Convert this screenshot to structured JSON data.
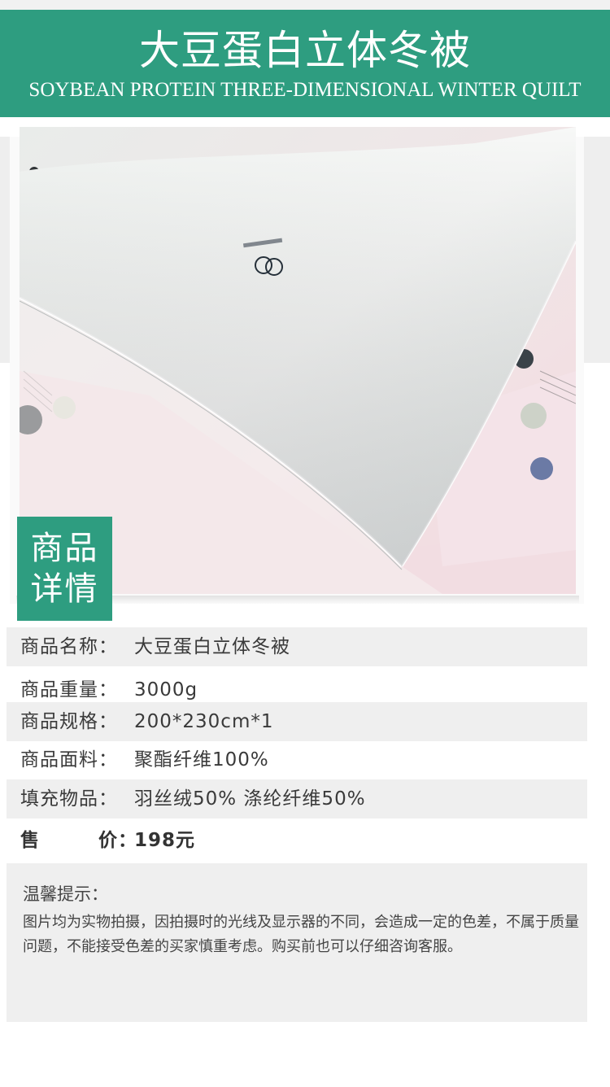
{
  "header": {
    "title": "大豆蛋白立体冬被",
    "subtitle": "SOYBEAN PROTEIN THREE-DIMENSIONAL WINTER QUILT",
    "bg_color": "#2e9d80"
  },
  "badge": {
    "line1": "商品",
    "line2": "详情"
  },
  "details": [
    {
      "label": "商品名称：",
      "value": "大豆蛋白立体冬被"
    },
    {
      "label": "商品重量：",
      "value": "3000g"
    },
    {
      "label": "商品规格：",
      "value": "200*230cm*1"
    },
    {
      "label": "商品面料：",
      "value": "聚酯纤维100%"
    },
    {
      "label": "填充物品：",
      "value": "羽丝绒50%   涤纶纤维50%"
    },
    {
      "label": "售        价：",
      "value": "198元"
    }
  ],
  "notice": {
    "title": "温馨提示：",
    "body": "图片均为实物拍摄，因拍摄时的光线及显示器的不同，会造成一定的色差，不属于质量问题，不能接受色差的买家慎重考虑。购买前也可以仔细咨询客服。"
  }
}
